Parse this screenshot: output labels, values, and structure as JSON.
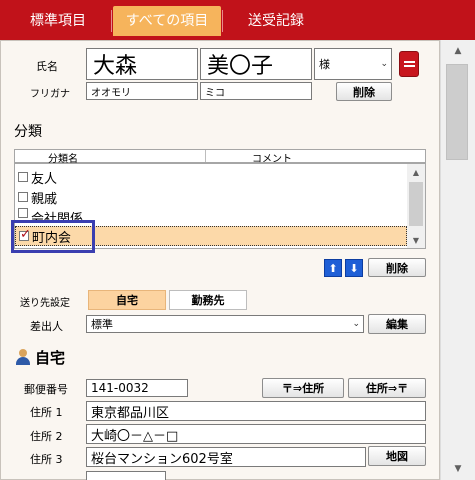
{
  "tabs": [
    {
      "label": "標準項目"
    },
    {
      "label": "すべての項目"
    },
    {
      "label": "送受記録"
    }
  ],
  "name": {
    "label": "氏名",
    "last_name": "大森",
    "first_name": "美〇子",
    "honorific": "様",
    "furigana_label": "フリガナ",
    "furigana_last": "オオモリ",
    "furigana_first": "ミコ",
    "delete_label": "削除"
  },
  "category": {
    "title": "分類",
    "col_name": "分類名",
    "col_comment": "コメント",
    "items": [
      {
        "label": "友人",
        "checked": false
      },
      {
        "label": "親戚",
        "checked": false
      },
      {
        "label": "会社関係",
        "checked": false
      },
      {
        "label": "町内会",
        "checked": true
      }
    ],
    "delete_label": "削除"
  },
  "send_to": {
    "label": "送り先設定",
    "options": [
      "自宅",
      "勤務先"
    ],
    "selected": "自宅"
  },
  "sender": {
    "label": "差出人",
    "value": "標準",
    "edit_label": "編集"
  },
  "home": {
    "title": "自宅",
    "postal_label": "郵便番号",
    "postal_value": "141-0032",
    "postal_to_addr": "〒⇒住所",
    "addr_to_postal": "住所⇒〒",
    "addr1_label": "住所 1",
    "addr1_value": "東京都品川区",
    "addr2_label": "住所 2",
    "addr2_value": "大崎〇－△－□",
    "addr3_label": "住所 3",
    "addr3_value": "桜台マンション602号室",
    "map_label": "地図"
  },
  "colors": {
    "tab_bar": "#c1121a",
    "tab_active": "#f6b45c",
    "selected_row": "#fcd9a9",
    "highlight": "#3a3eb0"
  }
}
